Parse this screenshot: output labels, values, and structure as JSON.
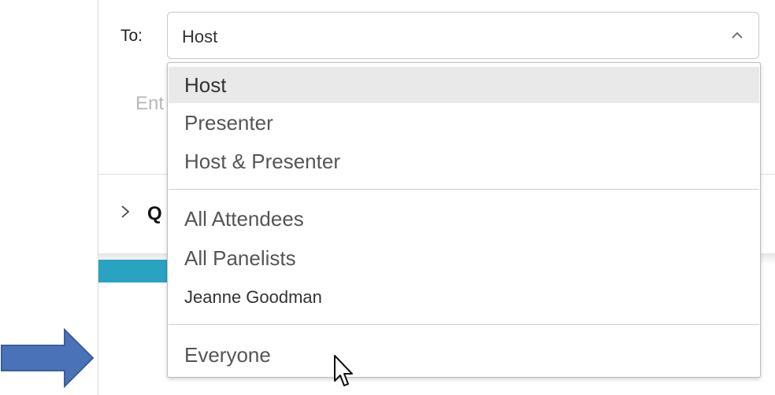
{
  "chat": {
    "to_label": "To:",
    "recipient_value": "Host",
    "message_placeholder": "Ent",
    "qa_section_label": "Q"
  },
  "dropdown": {
    "items": [
      {
        "label": "Host",
        "selected": true
      },
      {
        "label": "Presenter"
      },
      {
        "label": "Host & Presenter"
      },
      {
        "label": "All Attendees"
      },
      {
        "label": "All Panelists"
      },
      {
        "label": "Jeanne Goodman"
      },
      {
        "label": "Everyone"
      }
    ]
  },
  "icons": {
    "select_chevron": "chevron-up-icon",
    "qa_expand": "chevron-right-icon",
    "cursor": "mouse-pointer-icon",
    "annotation": "right-arrow-icon"
  },
  "colors": {
    "accent_teal": "#2aa3c0",
    "annotation_arrow": "#4a72b8",
    "selected_row": "#e9e9e9"
  }
}
